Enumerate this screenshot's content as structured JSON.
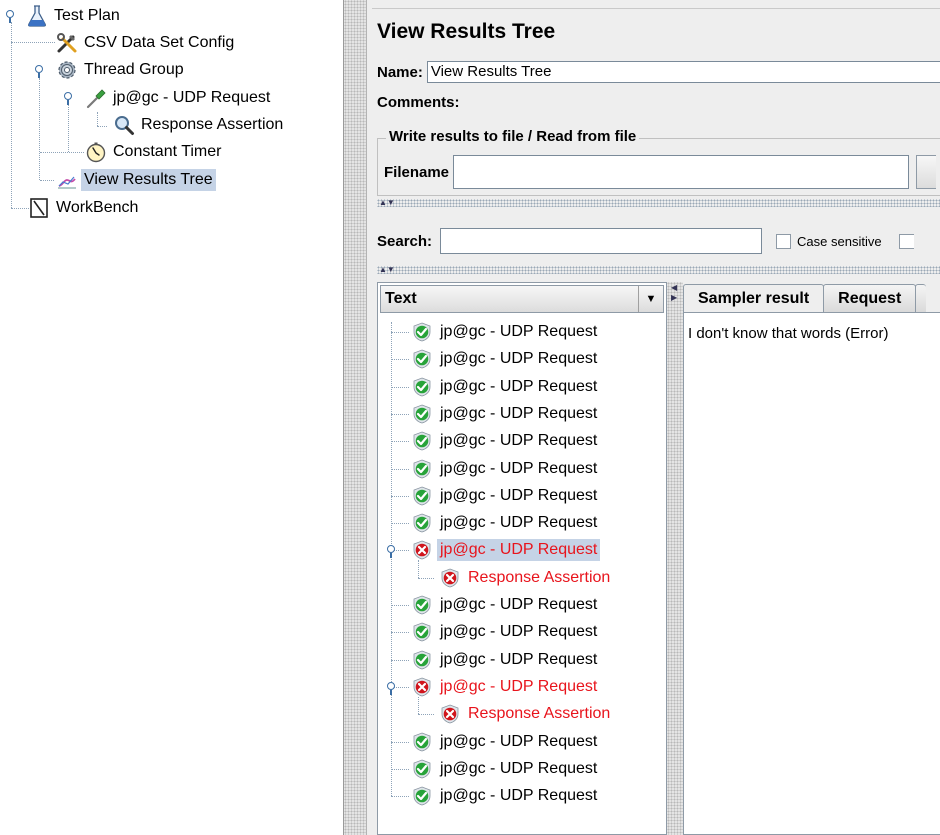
{
  "tree": {
    "nodes": [
      {
        "label": "Test Plan",
        "icon": "flask-icon"
      },
      {
        "label": "CSV Data Set Config",
        "icon": "tools-icon"
      },
      {
        "label": "Thread Group",
        "icon": "gear-icon"
      },
      {
        "label": "jp@gc - UDP Request",
        "icon": "pipette-icon"
      },
      {
        "label": "Response Assertion",
        "icon": "magnifier-icon"
      },
      {
        "label": "Constant Timer",
        "icon": "stopwatch-icon"
      },
      {
        "label": "View Results Tree",
        "icon": "chart-icon",
        "selected": true
      },
      {
        "label": "WorkBench",
        "icon": "notebook-icon"
      }
    ]
  },
  "panel": {
    "title": "View Results Tree",
    "name_label": "Name:",
    "name_value": "View Results Tree",
    "comments_label": "Comments:",
    "file_group_title": "Write results to file / Read from file",
    "filename_label": "Filename",
    "filename_value": "",
    "search_label": "Search:",
    "search_value": "",
    "case_sensitive_label": "Case sensitive"
  },
  "results": {
    "renderer": "Text",
    "rows": [
      {
        "label": "jp@gc - UDP Request",
        "status": "success"
      },
      {
        "label": "jp@gc - UDP Request",
        "status": "success"
      },
      {
        "label": "jp@gc - UDP Request",
        "status": "success"
      },
      {
        "label": "jp@gc - UDP Request",
        "status": "success"
      },
      {
        "label": "jp@gc - UDP Request",
        "status": "success"
      },
      {
        "label": "jp@gc - UDP Request",
        "status": "success"
      },
      {
        "label": "jp@gc - UDP Request",
        "status": "success"
      },
      {
        "label": "jp@gc - UDP Request",
        "status": "success"
      },
      {
        "label": "jp@gc - UDP Request",
        "status": "error",
        "selected": true
      },
      {
        "label": "Response Assertion",
        "status": "error",
        "child": true
      },
      {
        "label": "jp@gc - UDP Request",
        "status": "success"
      },
      {
        "label": "jp@gc - UDP Request",
        "status": "success"
      },
      {
        "label": "jp@gc - UDP Request",
        "status": "success"
      },
      {
        "label": "jp@gc - UDP Request",
        "status": "error"
      },
      {
        "label": "Response Assertion",
        "status": "error",
        "child": true
      },
      {
        "label": "jp@gc - UDP Request",
        "status": "success"
      },
      {
        "label": "jp@gc - UDP Request",
        "status": "success"
      },
      {
        "label": "jp@gc - UDP Request",
        "status": "success"
      }
    ]
  },
  "detail": {
    "tabs": [
      {
        "label": "Sampler result",
        "active": true
      },
      {
        "label": "Request"
      }
    ],
    "content": "I don't know that words (Error)"
  },
  "colors": {
    "success": "#27a339",
    "error": "#d0141c",
    "error_text": "#e8141c",
    "selection": "#c5d3e6"
  }
}
